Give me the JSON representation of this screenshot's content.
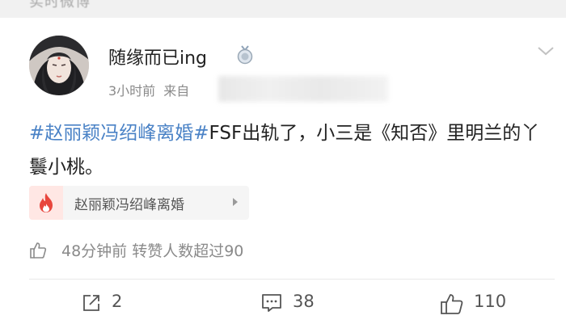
{
  "header": {
    "cut_text": "实时微博"
  },
  "post": {
    "username": "随缘而已ing",
    "time": "3小时前",
    "source_prefix": "来自",
    "hashtag": "#赵丽颖冯绍峰离婚#",
    "body": "FSF出轨了，小三是《知否》里明兰的丫鬟小桃。",
    "topic_label": "赵丽颖冯绍峰离婚",
    "like_info": "48分钟前 转赞人数超过90"
  },
  "actions": {
    "share_count": "2",
    "comment_count": "38",
    "like_count": "110"
  },
  "colors": {
    "hashtag": "#4a82c6",
    "fire": "#e8463d",
    "fire_bg": "#ffe7e4"
  },
  "icons": {
    "badge": "medal-icon",
    "more": "chevron-down-icon",
    "topic": "fire-icon",
    "like_info": "thumbs-up-icon",
    "share": "share-icon",
    "comment": "comment-icon",
    "like": "thumbs-up-icon"
  }
}
